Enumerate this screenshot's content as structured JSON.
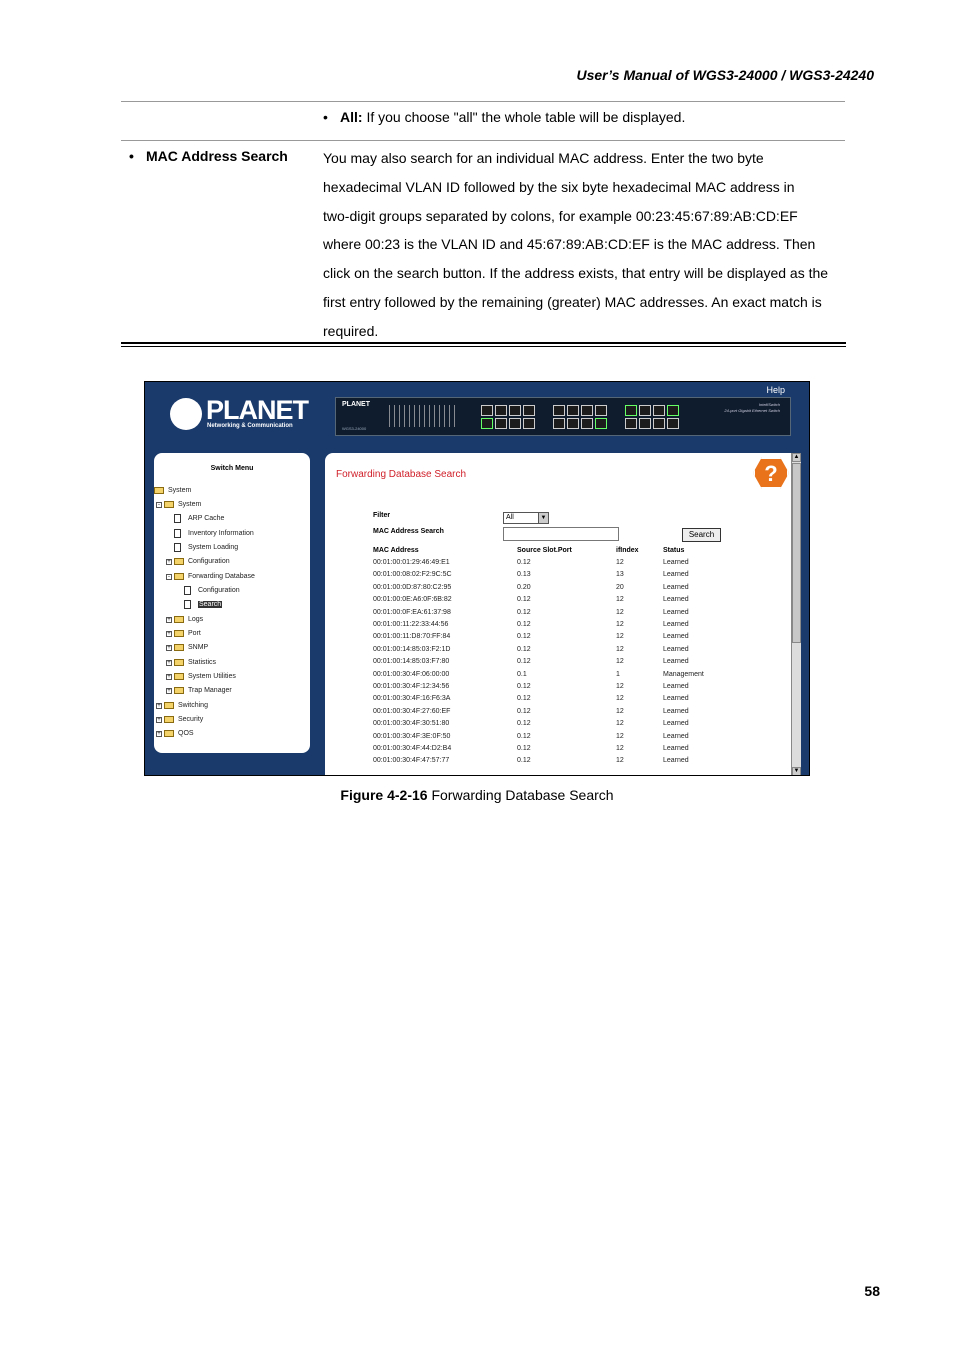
{
  "header": {
    "title": "User’s  Manual  of  WGS3-24000  /  WGS3-24240"
  },
  "all_option": {
    "term": "All:",
    "text": "If you choose \"all\" the whole table will be displayed."
  },
  "mac_search": {
    "label": "MAC Address Search",
    "lines": [
      "You may also search for an individual MAC address. Enter the two byte",
      "hexadecimal VLAN ID followed by the six byte hexadecimal MAC address in",
      "two-digit groups separated by colons, for example 00:23:45:67:89:AB:CD:EF",
      "where 00:23 is the VLAN ID and 45:67:89:AB:CD:EF is the MAC address. Then",
      "click on the search button. If the address exists, that entry will be displayed as the",
      "first entry followed by the remaining (greater) MAC addresses. An exact match is",
      "required."
    ]
  },
  "screenshot": {
    "help_link": "Help",
    "logo_text": "PLANET",
    "logo_sub": "Networking & Communication",
    "switch_brand": "PLANET",
    "switch_model": "WGS3-24000",
    "switch_desc_1": "IntelliSwitch",
    "switch_desc_2": "24-port Gigabit Ethernet Switch",
    "menu": {
      "title": "Switch Menu",
      "items": [
        "System",
        "System",
        "ARP Cache",
        "Inventory Information",
        "System Loading",
        "Configuration",
        "Forwarding Database",
        "Configuration",
        "Search",
        "Logs",
        "Port",
        "SNMP",
        "Statistics",
        "System Utilities",
        "Trap Manager",
        "Switching",
        "Security",
        "QOS"
      ]
    },
    "content": {
      "title": "Forwarding Database Search",
      "filter_label": "Filter",
      "filter_value": "All",
      "mac_search_label": "MAC Address Search",
      "search_button": "Search",
      "columns": [
        "MAC Address",
        "Source Slot.Port",
        "ifIndex",
        "Status"
      ],
      "rows": [
        [
          "00:01:00:01:29:46:49:E1",
          "0.12",
          "12",
          "Learned"
        ],
        [
          "00:01:00:08:02:F2:9C:5C",
          "0.13",
          "13",
          "Learned"
        ],
        [
          "00:01:00:0D:87:80:C2:95",
          "0.20",
          "20",
          "Learned"
        ],
        [
          "00:01:00:0E:A6:0F:6B:82",
          "0.12",
          "12",
          "Learned"
        ],
        [
          "00:01:00:0F:EA:61:37:98",
          "0.12",
          "12",
          "Learned"
        ],
        [
          "00:01:00:11:22:33:44:56",
          "0.12",
          "12",
          "Learned"
        ],
        [
          "00:01:00:11:D8:70:FF:84",
          "0.12",
          "12",
          "Learned"
        ],
        [
          "00:01:00:14:85:03:F2:1D",
          "0.12",
          "12",
          "Learned"
        ],
        [
          "00:01:00:14:85:03:F7:80",
          "0.12",
          "12",
          "Learned"
        ],
        [
          "00:01:00:30:4F:06:00:00",
          "0.1",
          "1",
          "Management"
        ],
        [
          "00:01:00:30:4F:12:34:56",
          "0.12",
          "12",
          "Learned"
        ],
        [
          "00:01:00:30:4F:16:F6:3A",
          "0.12",
          "12",
          "Learned"
        ],
        [
          "00:01:00:30:4F:27:60:EF",
          "0.12",
          "12",
          "Learned"
        ],
        [
          "00:01:00:30:4F:30:51:80",
          "0.12",
          "12",
          "Learned"
        ],
        [
          "00:01:00:30:4F:3E:0F:50",
          "0.12",
          "12",
          "Learned"
        ],
        [
          "00:01:00:30:4F:44:D2:B4",
          "0.12",
          "12",
          "Learned"
        ],
        [
          "00:01:00:30:4F:47:57:77",
          "0.12",
          "12",
          "Learned"
        ]
      ]
    }
  },
  "caption": {
    "label": "Figure 4-2-16",
    "text": "Forwarding Database Search"
  },
  "page_number": "58",
  "colors": {
    "title_red": "#d0202a",
    "frame_blue": "#1a3a6b",
    "help_orange": "#e8731a"
  }
}
